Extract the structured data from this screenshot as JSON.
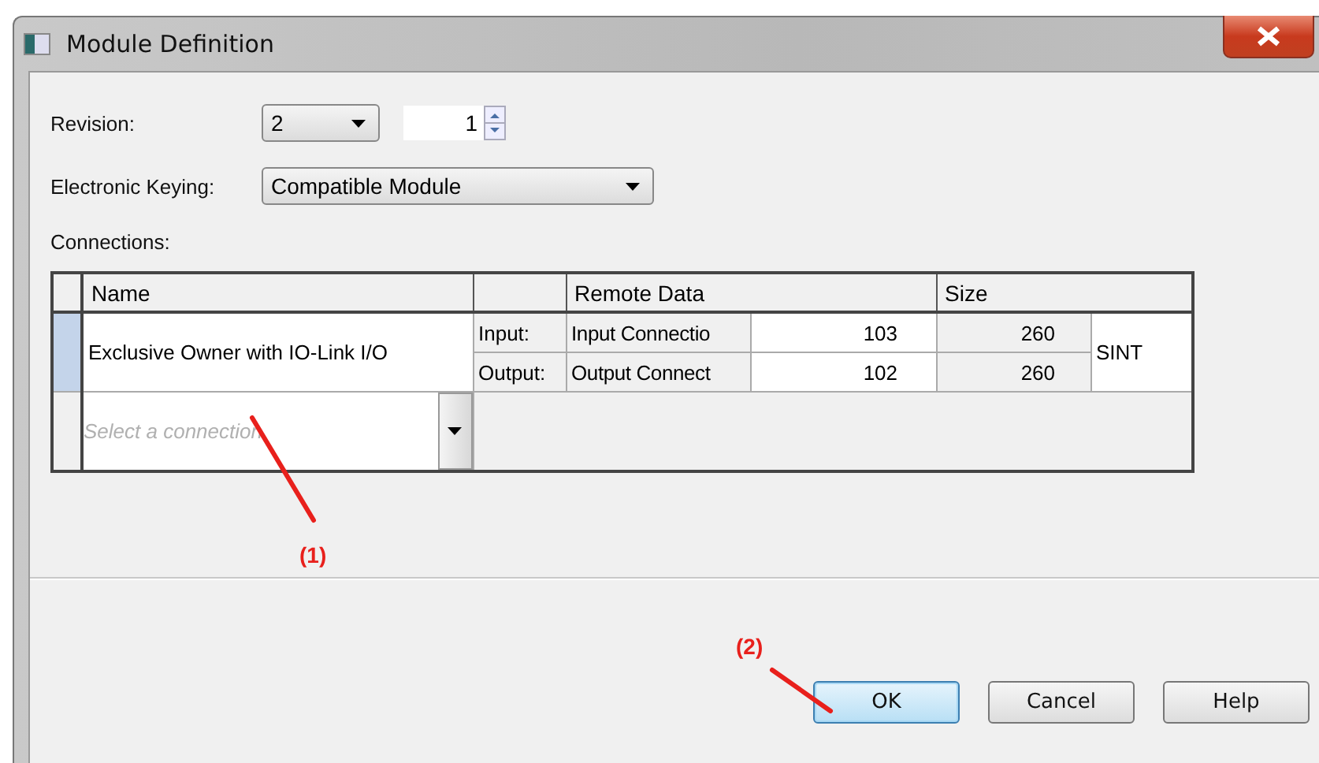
{
  "window": {
    "title": "Module Definition"
  },
  "revision": {
    "label": "Revision:",
    "major": "2",
    "minor": "1"
  },
  "electronic_keying": {
    "label": "Electronic Keying:",
    "value": "Compatible Module"
  },
  "connections": {
    "label": "Connections:",
    "columns": [
      "Name",
      "Remote Data",
      "Size"
    ],
    "rows": [
      {
        "name": "Exclusive Owner with IO-Link I/O",
        "selected": true,
        "size_type": "SINT",
        "parts": [
          {
            "direction": "Input:",
            "remote": "Input Connectio",
            "remote_value": "103",
            "size": "260"
          },
          {
            "direction": "Output:",
            "remote": "Output Connect",
            "remote_value": "102",
            "size": "260"
          }
        ]
      }
    ],
    "new_row": {
      "placeholder": "Select a connection"
    }
  },
  "buttons": [
    {
      "label": "OK",
      "focused": true
    },
    {
      "label": "Cancel",
      "focused": false
    },
    {
      "label": "Help",
      "focused": false
    }
  ],
  "annotations": [
    {
      "label": "(1)"
    },
    {
      "label": "(2)"
    }
  ]
}
